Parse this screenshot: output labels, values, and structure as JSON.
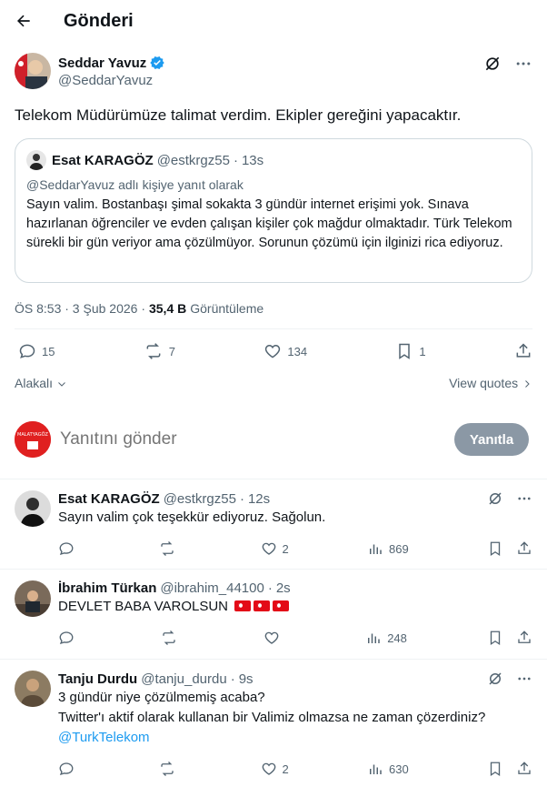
{
  "header": {
    "title": "Gönderi"
  },
  "post": {
    "author_name": "Seddar Yavuz",
    "author_handle": "@SeddarYavuz",
    "text": "Telekom Müdürümüze talimat verdim. Ekipler gereğini yapacaktır.",
    "quote": {
      "name": "Esat KARAGÖZ",
      "handle": "@estkrgz55",
      "time": "13s",
      "replying_to": "@SeddarYavuz adlı kişiye yanıt olarak",
      "text": "Sayın valim. Bostanbaşı  şimal sokakta 3 gündür internet erişimi yok. Sınava hazırlanan öğrenciler ve evden çalışan kişiler çok mağdur olmaktadır. Türk Telekom sürekli bir gün veriyor ama çözülmüyor. Sorunun çözümü için ilginizi rica ediyoruz."
    },
    "timestamp": "ÖS 8:53 · 3 Şub 2026 · ",
    "views_count": "35,4 B",
    "views_label": "Görüntüleme",
    "stats": {
      "replies": "15",
      "reposts": "7",
      "likes": "134",
      "bookmarks": "1"
    },
    "relevant_label": "Alakalı",
    "view_quotes_label": "View quotes"
  },
  "reply_composer": {
    "placeholder": "Yanıtını gönder",
    "button_label": "Yanıtla",
    "avatar_text": "MALATYAGÖZ"
  },
  "replies": [
    {
      "name": "Esat KARAGÖZ",
      "handle": "@estkrgz55",
      "time": "12s",
      "text": "Sayın valim çok teşekkür ediyoruz. Sağolun.",
      "replies": "",
      "reposts": "",
      "likes": "2",
      "views": "869"
    },
    {
      "name": "İbrahim Türkan",
      "handle": "@ibrahim_44100",
      "time": "2s",
      "text": "DEVLET BABA VAROLSUN",
      "flags": 3,
      "replies": "",
      "reposts": "",
      "likes": "",
      "views": "248"
    },
    {
      "name": "Tanju Durdu",
      "handle": "@tanju_durdu",
      "time": "9s",
      "text_lines": [
        "3 gündür niye çözülmemiş acaba?",
        "Twitter'ı aktif olarak kullanan bir Valimiz olmazsa ne zaman çözerdiniz?"
      ],
      "mention": "@TurkTelekom",
      "replies": "",
      "reposts": "",
      "likes": "2",
      "views": "630"
    }
  ],
  "colors": {
    "accent": "#1d9bf0",
    "muted": "#536471",
    "button": "#8b98a5",
    "verified": "#1d9bf0"
  },
  "icons": [
    "back-arrow-icon",
    "verified-icon",
    "grok-icon",
    "more-icon",
    "reply-icon",
    "repost-icon",
    "like-icon",
    "bookmark-icon",
    "share-icon",
    "views-icon",
    "chevron-down-icon",
    "chevron-right-icon"
  ]
}
